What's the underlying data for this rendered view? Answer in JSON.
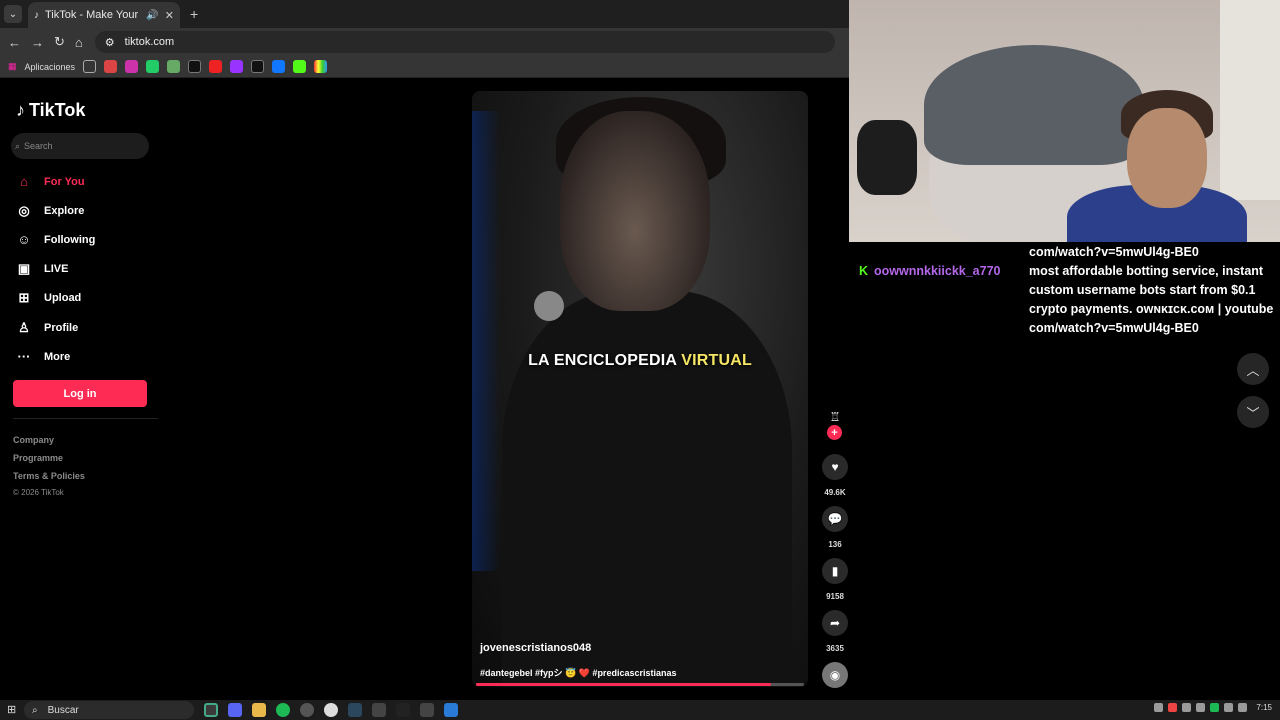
{
  "browser": {
    "tab_title": "TikTok - Make Your Day",
    "url": "tiktok.com",
    "bookmarks_label": "Aplicaciones",
    "bookmark_icons": [
      "apps-grid-icon",
      "gmail-icon",
      "instagram-icon",
      "whatsapp-icon",
      "sheet-icon",
      "x-icon",
      "youtube-icon",
      "twitch-icon",
      "tiktok-icon",
      "facebook-icon",
      "kick-icon",
      "multicolor-icon"
    ]
  },
  "sidebar": {
    "logo": "TikTok",
    "search_placeholder": "Search",
    "nav": [
      {
        "label": "For You",
        "icon": "home-icon",
        "active": true
      },
      {
        "label": "Explore",
        "icon": "compass-icon"
      },
      {
        "label": "Following",
        "icon": "following-icon"
      },
      {
        "label": "LIVE",
        "icon": "live-icon"
      },
      {
        "label": "Upload",
        "icon": "upload-icon"
      },
      {
        "label": "Profile",
        "icon": "profile-icon"
      },
      {
        "label": "More",
        "icon": "more-icon"
      }
    ],
    "login": "Log in",
    "footer": [
      "Company",
      "Programme",
      "Terms & Policies"
    ],
    "copyright": "© 2026 TikTok"
  },
  "video": {
    "caption_main": "LA ENCICLOPEDIA ",
    "caption_highlight": "VIRTUAL",
    "author": "jovenescristianos048",
    "tags": "#dantegebel #fypシ 😇 ❤️ #predicascristianas",
    "progress": 0.9
  },
  "actions": {
    "likes": "49.6K",
    "comments": "136",
    "saves": "9158",
    "shares": "3635"
  },
  "chat": {
    "line1": "com/watch?v=5mwUl4g-BE0",
    "username": "oowwnnkkiickk_a770",
    "line2": "most affordable botting service, instant",
    "line3": "custom username bots start from $0.1",
    "line4": "crypto payments. ᴏᴡɴᴋɪᴄᴋ.ᴄᴏᴍ | youtube",
    "line5": "com/watch?v=5mwUl4g-BE0"
  },
  "taskbar": {
    "search": "Buscar",
    "time": "7:15"
  },
  "colors": {
    "accent": "#fe2c55",
    "highlight_text": "#f5e663",
    "chat_username": "#b467e8",
    "kick_green": "#53fc18"
  }
}
